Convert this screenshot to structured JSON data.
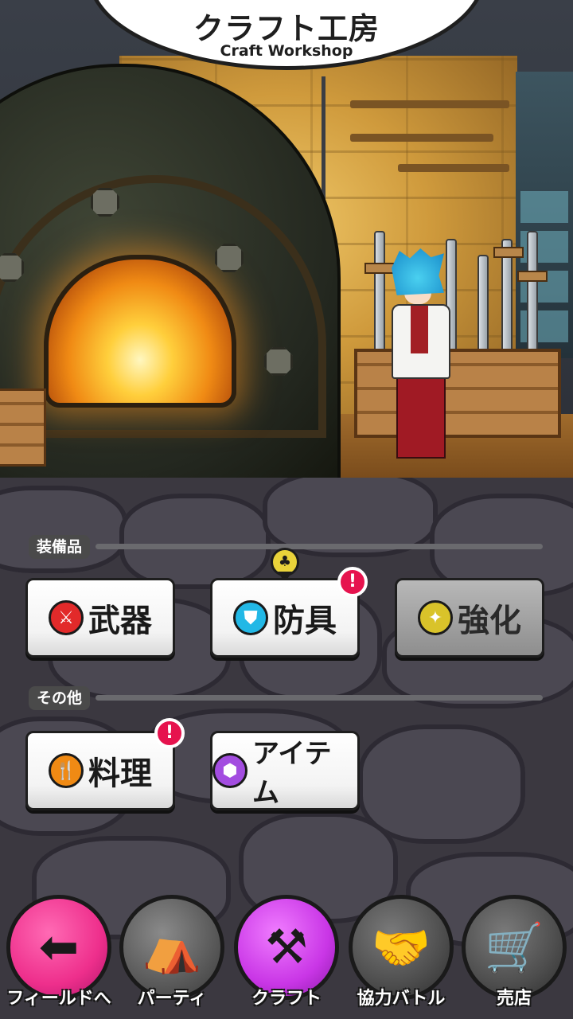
{
  "header": {
    "title_jp": "クラフト工房",
    "title_en": "Craft Workshop"
  },
  "sections": {
    "equipment": {
      "label": "装備品",
      "buttons": [
        {
          "label": "武器",
          "icon": "sword-icon",
          "icon_color": "#e22a2a",
          "state": "enabled"
        },
        {
          "label": "防具",
          "icon": "armor-icon",
          "icon_color": "#22b8e6",
          "state": "enabled",
          "badge": "!",
          "pin_icon": "tree-icon"
        },
        {
          "label": "強化",
          "icon": "sparkle-icon",
          "icon_color": "#d9c32a",
          "state": "disabled"
        }
      ]
    },
    "other": {
      "label": "その他",
      "buttons": [
        {
          "label": "料理",
          "icon": "cutlery-icon",
          "icon_color": "#f08a14",
          "state": "enabled",
          "badge": "!"
        },
        {
          "label": "アイテム",
          "icon": "cube-icon",
          "icon_color": "#a34de0",
          "state": "enabled"
        }
      ]
    }
  },
  "nav": [
    {
      "label": "フィールドへ",
      "icon": "arrow-left-icon",
      "color": "#ee2f8c",
      "active": false
    },
    {
      "label": "パーティ",
      "icon": "tent-icon",
      "color": "#9bc23a",
      "active": false
    },
    {
      "label": "クラフト",
      "icon": "crossed-tools-icon",
      "color": "#c936e6",
      "active": true
    },
    {
      "label": "協力バトル",
      "icon": "handshake-icon",
      "color": "#6a6a6a",
      "active": false
    },
    {
      "label": "売店",
      "icon": "shop-cart-icon",
      "color": "#6a6a6a",
      "active": false
    }
  ],
  "colors": {
    "badge": "#e6134e",
    "active_nav": "#c936e6"
  }
}
